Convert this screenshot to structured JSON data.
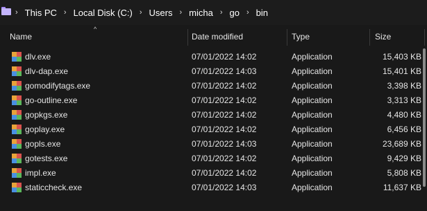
{
  "breadcrumb": {
    "items": [
      "This PC",
      "Local Disk (C:)",
      "Users",
      "micha",
      "go",
      "bin"
    ]
  },
  "columns": {
    "name": "Name",
    "date": "Date modified",
    "type": "Type",
    "size": "Size",
    "sort_indicator": "^"
  },
  "files": [
    {
      "name": "dlv.exe",
      "date": "07/01/2022 14:02",
      "type": "Application",
      "size": "15,403 KB"
    },
    {
      "name": "dlv-dap.exe",
      "date": "07/01/2022 14:03",
      "type": "Application",
      "size": "15,401 KB"
    },
    {
      "name": "gomodifytags.exe",
      "date": "07/01/2022 14:02",
      "type": "Application",
      "size": "3,398 KB"
    },
    {
      "name": "go-outline.exe",
      "date": "07/01/2022 14:02",
      "type": "Application",
      "size": "3,313 KB"
    },
    {
      "name": "gopkgs.exe",
      "date": "07/01/2022 14:02",
      "type": "Application",
      "size": "4,480 KB"
    },
    {
      "name": "goplay.exe",
      "date": "07/01/2022 14:02",
      "type": "Application",
      "size": "6,456 KB"
    },
    {
      "name": "gopls.exe",
      "date": "07/01/2022 14:03",
      "type": "Application",
      "size": "23,689 KB"
    },
    {
      "name": "gotests.exe",
      "date": "07/01/2022 14:02",
      "type": "Application",
      "size": "9,429 KB"
    },
    {
      "name": "impl.exe",
      "date": "07/01/2022 14:02",
      "type": "Application",
      "size": "5,808 KB"
    },
    {
      "name": "staticcheck.exe",
      "date": "07/01/2022 14:03",
      "type": "Application",
      "size": "11,637 KB"
    }
  ],
  "icons": {
    "folder": "folder-icon",
    "file": "application-icon",
    "separator": "chevron-right-icon"
  }
}
